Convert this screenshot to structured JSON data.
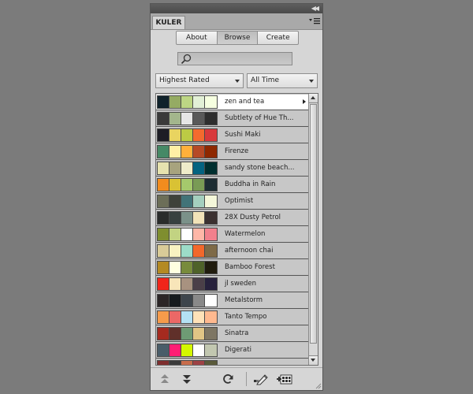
{
  "panel": {
    "title": "KULER"
  },
  "tabs": [
    {
      "label": "About",
      "active": false
    },
    {
      "label": "Browse",
      "active": true
    },
    {
      "label": "Create",
      "active": false
    }
  ],
  "search": {
    "value": "",
    "placeholder": ""
  },
  "filters": {
    "sort": "Highest Rated",
    "time": "All Time"
  },
  "themes": [
    {
      "name": "zen and tea",
      "selected": true,
      "colors": [
        "#10222B",
        "#95AB63",
        "#BDD684",
        "#E2F0D6",
        "#F6FFE0"
      ]
    },
    {
      "name": "Subtlety of Hue Th...",
      "selected": false,
      "colors": [
        "#3A3A3A",
        "#A3B68C",
        "#E6E6E6",
        "#595959",
        "#2E2E2E"
      ]
    },
    {
      "name": "Sushi Maki",
      "selected": false,
      "colors": [
        "#1D1D25",
        "#E9D460",
        "#BCCB44",
        "#F36A2E",
        "#D8383B"
      ]
    },
    {
      "name": "Firenze",
      "selected": false,
      "colors": [
        "#468966",
        "#FFF0A5",
        "#FFB03B",
        "#B64926",
        "#8E2800"
      ]
    },
    {
      "name": "sandy stone beach...",
      "selected": false,
      "colors": [
        "#E6E2AF",
        "#A7A37E",
        "#EFECCA",
        "#046380",
        "#002F2F"
      ]
    },
    {
      "name": "Buddha in Rain",
      "selected": false,
      "colors": [
        "#F28C1E",
        "#D9C234",
        "#A5C96C",
        "#799B55",
        "#1D2D33"
      ]
    },
    {
      "name": "Optimist",
      "selected": false,
      "colors": [
        "#6C6E58",
        "#3E423A",
        "#417378",
        "#A4CFBE",
        "#F4F7D9"
      ]
    },
    {
      "name": "28X Dusty Petrol",
      "selected": false,
      "colors": [
        "#2A2C2B",
        "#374140",
        "#7B9189",
        "#F2E3B8",
        "#3B3130"
      ]
    },
    {
      "name": "Watermelon",
      "selected": false,
      "colors": [
        "#7F8E2F",
        "#C2D382",
        "#FFFFFF",
        "#FFB7A8",
        "#F2808C"
      ]
    },
    {
      "name": "afternoon chai",
      "selected": false,
      "colors": [
        "#D9CB98",
        "#F8F2C1",
        "#9DDCC8",
        "#F2682B",
        "#7E6A47"
      ]
    },
    {
      "name": "Bamboo Forest",
      "selected": false,
      "colors": [
        "#B48A23",
        "#FFFFE0",
        "#788B3C",
        "#4F6229",
        "#201C0E"
      ]
    },
    {
      "name": "jl sweden",
      "selected": false,
      "colors": [
        "#F1251A",
        "#F8E5B9",
        "#A89280",
        "#4B3F48",
        "#27213C"
      ]
    },
    {
      "name": "Metalstorm",
      "selected": false,
      "colors": [
        "#2B2526",
        "#161B1E",
        "#3E454C",
        "#898989",
        "#FFFFFF"
      ]
    },
    {
      "name": "Tanto Tempo",
      "selected": false,
      "colors": [
        "#F69B4B",
        "#EB6866",
        "#B4E1F4",
        "#FFE2B8",
        "#FFB98F"
      ]
    },
    {
      "name": "Sinatra",
      "selected": false,
      "colors": [
        "#A52A1F",
        "#60302A",
        "#6E9B74",
        "#E0C585",
        "#7E7663"
      ]
    },
    {
      "name": "Digerati",
      "selected": false,
      "colors": [
        "#495D69",
        "#FF1E74",
        "#D4F700",
        "#FFFFFF",
        "#C2C7B0"
      ]
    },
    {
      "name": "",
      "selected": false,
      "colors": [
        "#7E2E2E",
        "#3A3A3A",
        "#C86D4C",
        "#9E4245",
        "#5A5A3A"
      ]
    }
  ],
  "icons": {
    "menu": "panel-menu-icon",
    "search": "magnifier-icon",
    "prev": "previous-set-icon",
    "next": "next-set-icon",
    "refresh": "refresh-icon",
    "edit": "edit-theme-icon",
    "add": "add-to-swatches-icon"
  }
}
